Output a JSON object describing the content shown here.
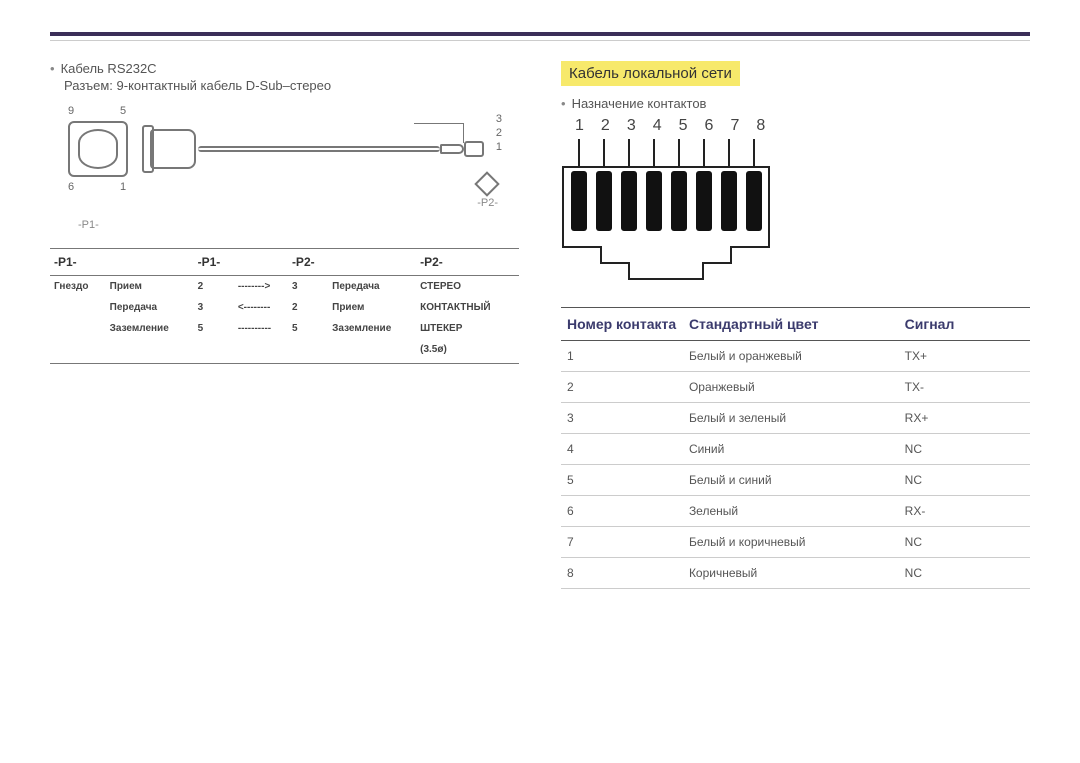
{
  "left": {
    "cable_title": "Кабель RS232C",
    "connector_desc": "Разъем: 9-контактный кабель D-Sub–стерео",
    "pin_labels": {
      "top_left": "9",
      "top_right": "5",
      "bottom_left": "6",
      "bottom_right": "1",
      "jack_1": "3",
      "jack_2": "2",
      "jack_3": "1",
      "p1": "-P1-",
      "p2": "-P2-"
    },
    "table_headers": [
      "-P1-",
      "-P1-",
      "-P2-",
      "-P2-"
    ],
    "table_rows": [
      [
        "Гнездо",
        "Прием",
        "2",
        "-------->",
        "3",
        "Передача",
        "СТЕРЕО"
      ],
      [
        "",
        "Передача",
        "3",
        "<--------",
        "2",
        "Прием",
        "КОНТАКТНЫЙ"
      ],
      [
        "",
        "Заземление",
        "5",
        "----------",
        "5",
        "Заземление",
        "ШТЕКЕР"
      ],
      [
        "",
        "",
        "",
        "",
        "",
        "",
        "(3.5ø)"
      ]
    ]
  },
  "right": {
    "heading": "Кабель локальной сети",
    "pin_assignment": "Назначение контактов",
    "rj45_numbers": [
      "1",
      "2",
      "3",
      "4",
      "5",
      "6",
      "7",
      "8"
    ],
    "table_headers": {
      "pin": "Номер контакта",
      "color": "Стандартный цвет",
      "signal": "Сигнал"
    },
    "rows": [
      {
        "pin": "1",
        "color": "Белый и оранжевый",
        "signal": "TX+"
      },
      {
        "pin": "2",
        "color": "Оранжевый",
        "signal": "TX-"
      },
      {
        "pin": "3",
        "color": "Белый и зеленый",
        "signal": "RX+"
      },
      {
        "pin": "4",
        "color": "Синий",
        "signal": "NC"
      },
      {
        "pin": "5",
        "color": "Белый и синий",
        "signal": "NC"
      },
      {
        "pin": "6",
        "color": "Зеленый",
        "signal": "RX-"
      },
      {
        "pin": "7",
        "color": "Белый и коричневый",
        "signal": "NC"
      },
      {
        "pin": "8",
        "color": "Коричневый",
        "signal": "NC"
      }
    ]
  }
}
